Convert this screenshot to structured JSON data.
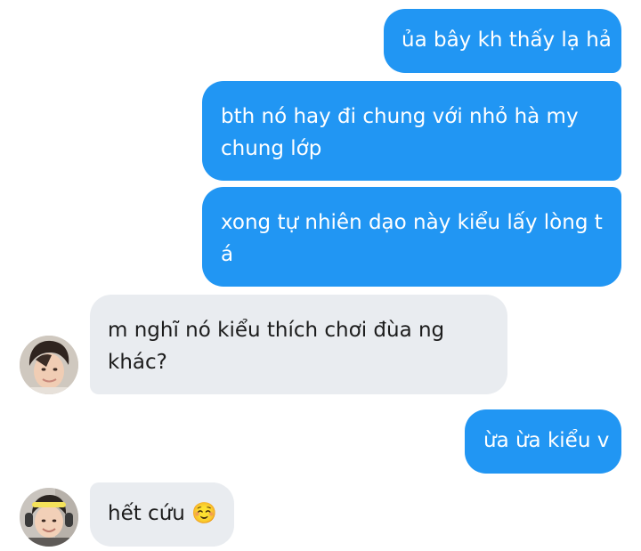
{
  "messages": [
    {
      "id": 1,
      "direction": "outgoing",
      "lines": [
        "ủa bây kh thấy lạ hả"
      ]
    },
    {
      "id": 2,
      "direction": "outgoing",
      "lines": [
        "bth nó hay đi chung với nhỏ hà my",
        "chung lớp"
      ]
    },
    {
      "id": 3,
      "direction": "outgoing",
      "lines": [
        "xong tự nhiên dạo này kiểu lấy lòng t",
        "á"
      ]
    },
    {
      "id": 4,
      "direction": "incoming",
      "lines": [
        "m nghĩ nó kiểu thích chơi đùa ng",
        "khác?"
      ]
    },
    {
      "id": 5,
      "direction": "outgoing",
      "lines": [
        "ừa ừa kiểu v"
      ]
    },
    {
      "id": 6,
      "direction": "incoming",
      "lines": [
        "hết cứu ☺️"
      ]
    }
  ],
  "colors": {
    "outgoing_bubble": "#2196f3",
    "incoming_bubble": "#e9ecf0",
    "outgoing_text": "#ffffff",
    "incoming_text": "#1c1c1c"
  },
  "icons": {
    "emoji": "smiling-face-emoji"
  }
}
